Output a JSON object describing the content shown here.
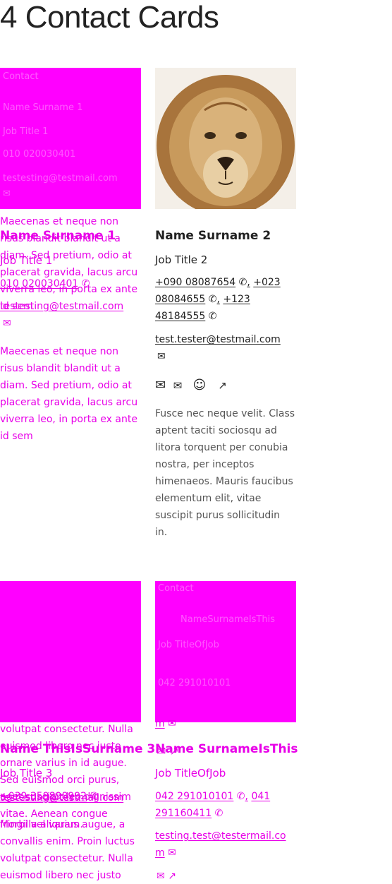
{
  "page": {
    "title": "4 Contact Cards"
  },
  "cards": [
    {
      "image_broken": true,
      "image_alt_lines": [
        "Contact",
        "Name Surname 1",
        "Job Title 1",
        "010 020030401",
        "testesting@testmail.com"
      ],
      "name": "Name Surname 1",
      "job": "Job Title 1",
      "phones": [
        "010 020030401"
      ],
      "email": "testesting@testmail.com",
      "lead_text_lines": [
        "Maecenas et neque non",
        "risus blandit blandit ut a",
        "diam. Sed pretium, odio at",
        "placerat gravida, lacus arcu",
        "viverra leo, in porta ex ante",
        "id sem"
      ],
      "description_lines": [
        "Maecenas et neque non",
        "risus blandit blandit ut a",
        "diam. Sed pretium, odio at",
        "placerat gravida, lacus arcu",
        "viverra leo, in porta ex ante",
        "id sem"
      ]
    },
    {
      "image_broken": false,
      "name": "Name Surname 2",
      "job": "Job Title 2",
      "phone_lines": [
        [
          "+090 08087654",
          "+023"
        ],
        [
          "08084655",
          "+123"
        ],
        [
          "48184555"
        ]
      ],
      "email": "test.tester@testmail.com",
      "social_icons": [
        "envelope-icon",
        "mail-icon",
        "smiley-icon",
        "external-link-icon"
      ],
      "description_lines": [
        "Fusce nec neque velit. Class",
        "aptent taciti sociosqu ad",
        "litora torquent per conubia",
        "nostra, per inceptos",
        "himenaeos. Mauris faucibus",
        "elementum elit, vitae",
        "suscipit purus sollicitudin",
        "in."
      ]
    },
    {
      "image_broken": true,
      "name": "Name ThisIsSurname 3",
      "job": "Job Title 3",
      "phones": [
        "+039 359898992"
      ],
      "email": "testesting@testmail.com",
      "overflow_text_lines": [
        "volutpat consectetur. Nulla",
        "euismod libero nec justo",
        "ornare varius in id augue.",
        "Sed euismod orci purus,",
        "eget suscipit leo dignissim",
        "vitae. Aenean congue",
        "fringilla aliquam.",
        "Morbi vel varius augue, a",
        "convallis enim. Proin luctus",
        "volutpat consectetur. Nulla",
        "euismod libero nec justo"
      ]
    },
    {
      "image_broken": true,
      "image_alt_lines": [
        "Contact",
        "NameSurnameIsThis",
        "Job TitleOfJob",
        "042 291010101"
      ],
      "name": "Name SurnameIsThis",
      "job": "Job TitleOfJob",
      "phone_lines": [
        [
          "042 291010101",
          "041"
        ],
        [
          "291160411"
        ]
      ],
      "email_lines": [
        "testing.test@testermail.co",
        "m"
      ]
    }
  ],
  "colors": {
    "broken_image": "#ff00ff",
    "overlay_text": "#e800e8",
    "text": "#222222"
  }
}
